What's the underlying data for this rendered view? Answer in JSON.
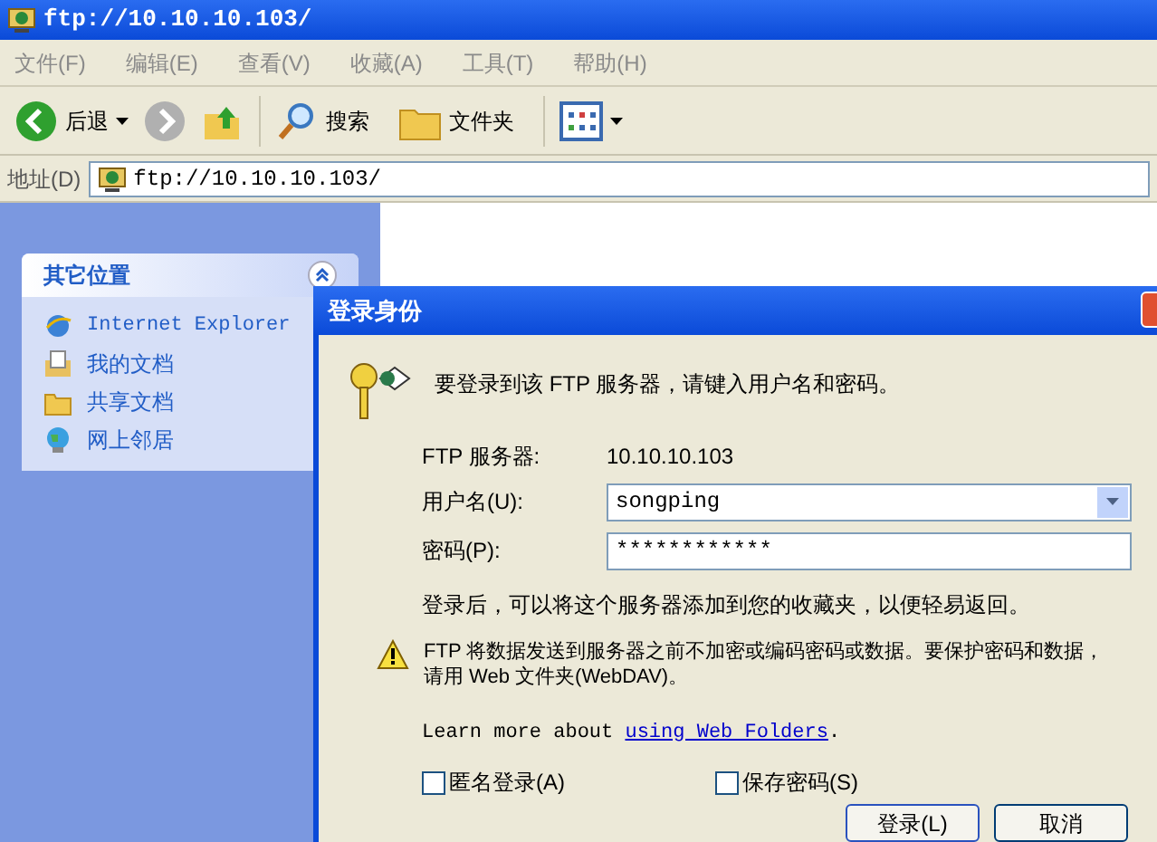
{
  "window": {
    "title": "ftp://10.10.10.103/"
  },
  "menu": [
    "文件(F)",
    "编辑(E)",
    "查看(V)",
    "收藏(A)",
    "工具(T)",
    "帮助(H)"
  ],
  "toolbar": {
    "back": "后退",
    "search": "搜索",
    "folders": "文件夹"
  },
  "address": {
    "label": "地址(D)",
    "value": "ftp://10.10.10.103/"
  },
  "sidebar": {
    "title": "其它位置",
    "expanded": true,
    "items": [
      {
        "label": "Internet Explorer",
        "kind": "browser"
      },
      {
        "label": "我的文档",
        "kind": "documents"
      },
      {
        "label": "共享文档",
        "kind": "folder"
      },
      {
        "label": "网上邻居",
        "kind": "network"
      }
    ]
  },
  "dialog": {
    "title": "登录身份",
    "intro": "要登录到该 FTP 服务器，请键入用户名和密码。",
    "server_label": "FTP 服务器:",
    "server": "10.10.10.103",
    "user_label": "用户名(U):",
    "user": "songping",
    "password_label": "密码(P):",
    "password": "************",
    "note": "登录后，可以将这个服务器添加到您的收藏夹，以便轻易返回。",
    "warning": "FTP 将数据发送到服务器之前不加密或编码密码或数据。要保护密码和数据，请用 Web 文件夹(WebDAV)。",
    "learn_prefix": "Learn more about",
    "learn_link": "using Web Folders",
    "learn_suffix": ".",
    "checkboxes": [
      {
        "label": "匿名登录(A)",
        "checked": false
      },
      {
        "label": "保存密码(S)",
        "checked": false
      }
    ],
    "buttons": [
      "登录(L)",
      "取消"
    ]
  }
}
